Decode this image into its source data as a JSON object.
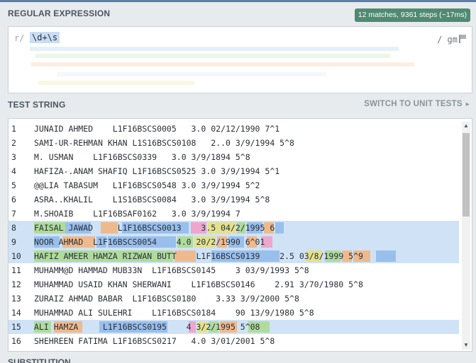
{
  "regex_section": {
    "title": "REGULAR EXPRESSION",
    "match_info": "12 matches, 9361 steps (~17ms)",
    "delimiter": "r/",
    "pattern": "\\d+\\s",
    "flags": "/ gm",
    "flag_icon": "flag-icon"
  },
  "test_section": {
    "title": "TEST STRING",
    "switch_label": "SWITCH TO UNIT TESTS",
    "lines": [
      {
        "num": "1",
        "text": "JUNAID AHMED    L1F16BSCS0005   3.0 02/12/1990 7^1"
      },
      {
        "num": "2",
        "text": "SAMI-UR-REHMAN KHAN L1S16BSCS0108   2..0 3/9/1994 5^8"
      },
      {
        "num": "3",
        "text": "M. USMAN    L1F16BSCS0339   3.0 3/9/1894 5^8"
      },
      {
        "num": "4",
        "text": "HAFIZA-.ANAM SHAFIQ L1F16BSCS0525 3.0 3/9/1994 5^1"
      },
      {
        "num": "5",
        "text": "@@LIA TABASUM   L1F16BSCS0548 3.0 3/9/1994 5^2"
      },
      {
        "num": "6",
        "text": "ASRA..KHALIL    L1S16BSCS0084   3.0 3/9/1994 5^8"
      },
      {
        "num": "7",
        "text": "M.SHOAIB    L1F16BSAF0162   3.0 3/9/1994 7"
      },
      {
        "num": "8",
        "text": "FAISAL JAWAD     L1F16BSCS0013    3.5 04/2/1995 6"
      },
      {
        "num": "9",
        "text": "NOOR AHMAD  L1F16BSCS0054    4.0 20/2/1990 6^01"
      },
      {
        "num": "10",
        "text": "HAFIZ AMEER HAMZA RIZWAN BUTT    L1F16BSCS0139    2.5 03/8/1999 5^9"
      },
      {
        "num": "11",
        "text": "MUHAMM@D HAMMAD MUB33N  L1F16BSCS0145    3 03/9/1993 5^8"
      },
      {
        "num": "12",
        "text": "MUHAMMAD USAID KHAN SHERWANI    L1F16BSCS0146    2.91 3/70/1980 5^8"
      },
      {
        "num": "13",
        "text": "ZURAIZ AHMAD BABAR  L1F16BSCS0180    3.33 3/9/2000 5^8"
      },
      {
        "num": "14",
        "text": "MUHAMMAD ALI SULEHRI    L1F16BSCS0184    90 13/9/1980 5^8"
      },
      {
        "num": "15",
        "text": "ALI HAMZA     L1F16BSCS0195    4 3/2/1995 5^08"
      },
      {
        "num": "16",
        "text": "SHEHREEN FATIMA L1F16BSCS0217   4.0 3/01/2001 5^8"
      }
    ]
  },
  "substitution_section": {
    "title": "SUBSTITUTION"
  },
  "colors": {
    "match_badge": "#4f8a72",
    "selection": "#c9ddf3",
    "highlight_blue": "#8fb9ea",
    "highlight_green": "#a9d98c",
    "highlight_orange": "#f3b37a",
    "highlight_pink": "#f29bc4",
    "highlight_yellow": "#e7e07a"
  }
}
